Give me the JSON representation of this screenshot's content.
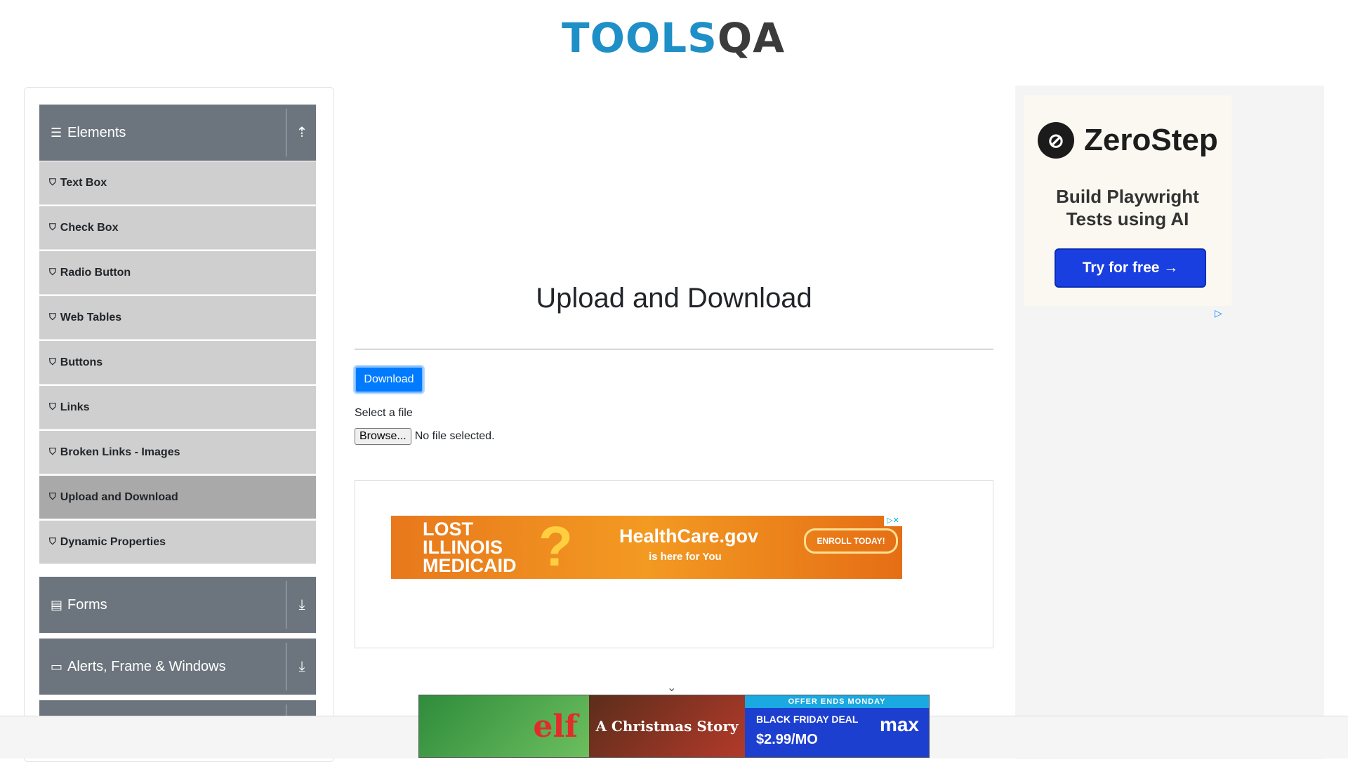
{
  "header": {
    "logo_tools": "TOOLS",
    "logo_qa": "QA"
  },
  "sidebar": {
    "groups": [
      {
        "label": "Elements",
        "icon": "hamburger-icon",
        "toggle": "upload-arrow-icon"
      },
      {
        "label": "Forms",
        "icon": "document-icon",
        "toggle": "download-arrow-icon"
      },
      {
        "label": "Alerts, Frame & Windows",
        "icon": "window-icon",
        "toggle": "download-arrow-icon"
      }
    ],
    "items": [
      {
        "label": "Text Box"
      },
      {
        "label": "Check Box"
      },
      {
        "label": "Radio Button"
      },
      {
        "label": "Web Tables"
      },
      {
        "label": "Buttons"
      },
      {
        "label": "Links"
      },
      {
        "label": "Broken Links - Images"
      },
      {
        "label": "Upload and Download",
        "active": true
      },
      {
        "label": "Dynamic Properties"
      }
    ]
  },
  "main": {
    "title": "Upload and Download",
    "download_label": "Download",
    "select_label": "Select a file",
    "browse_label": "Browse...",
    "file_status": "No file selected."
  },
  "ads": {
    "center_banner": {
      "left_text_1": "LOST",
      "left_text_2": "ILLINOIS",
      "left_text_3": "MEDICAID",
      "question": "?",
      "brand": "HealthCare.gov",
      "tagline": "is here for You",
      "cta": "ENROLL TODAY!"
    },
    "right": {
      "brand": "ZeroStep",
      "tagline_1": "Build Playwright",
      "tagline_2": "Tests using AI",
      "cta": "Try for free →"
    },
    "bottom": {
      "elf": "elf",
      "xmas": "A Christmas Story",
      "offer": "OFFER ENDS MONDAY",
      "deal": "BLACK FRIDAY DEAL",
      "price": "$2.99/MO",
      "logo": "max"
    }
  },
  "colors": {
    "accent": "#007bff",
    "sidebar_header": "#6c757d",
    "menu_item": "#cfcfcf",
    "menu_active": "#a9a9a9"
  }
}
